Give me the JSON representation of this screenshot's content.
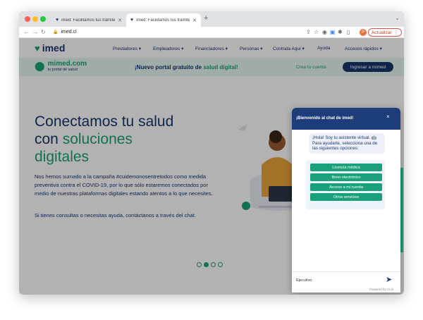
{
  "browser": {
    "tabs": [
      {
        "title": "imed: Facilitamos tus trámites"
      },
      {
        "title": "Imed: Facilitamos tus trámites"
      }
    ],
    "new_tab": "+",
    "url": "imed.cl",
    "update_label": "Actualizar",
    "avatar_letter": "P"
  },
  "site": {
    "logo": "imed",
    "nav": [
      "Prestadores",
      "Empleadores",
      "Financiadores",
      "Personas",
      "Contrata Aquí",
      "Ayuda",
      "Accesos rápidos"
    ],
    "banner": {
      "brand": "mimed.com",
      "brand_sub": "tu portal de salud",
      "promo_prefix": "¡Nuevo portal gratuito de ",
      "promo_highlight": "salud digital!",
      "create_account": "Crea tu cuenta",
      "login": "Ingresar a mimed"
    },
    "hero": {
      "title_line1": "Conectamos tu salud",
      "title_line2_prefix": "con ",
      "title_line2_highlight": "soluciones",
      "title_line3": "digitales",
      "para1": "Nos hemos sumado a la campaña #cuidemonosentretodos como medida preventiva contra el COVID-19, por lo que sólo estaremos conectados por medio de nuestras plataformas digitales estando atentos a lo que necesites.",
      "para2": "Si tienes consultas o necesitas ayuda, contáctanos a través del chat."
    }
  },
  "chat": {
    "title": "¡Bienvenido al chat de imed!",
    "close": "×",
    "greeting": "¡Hola! Soy tu asistente virtual. 🤖 Para ayudarte, selecciona una de las siguientes opciones:",
    "options": [
      "Licencia médica",
      "Bono electrónico",
      "Acceso a mi cuenta",
      "Otros servicios"
    ],
    "input_label": "Ejecutivo",
    "powered_by": "Powered by CLO"
  },
  "colors": {
    "navy": "#18356b",
    "green": "#1aa17a",
    "chat_header": "#1c3d7a"
  }
}
